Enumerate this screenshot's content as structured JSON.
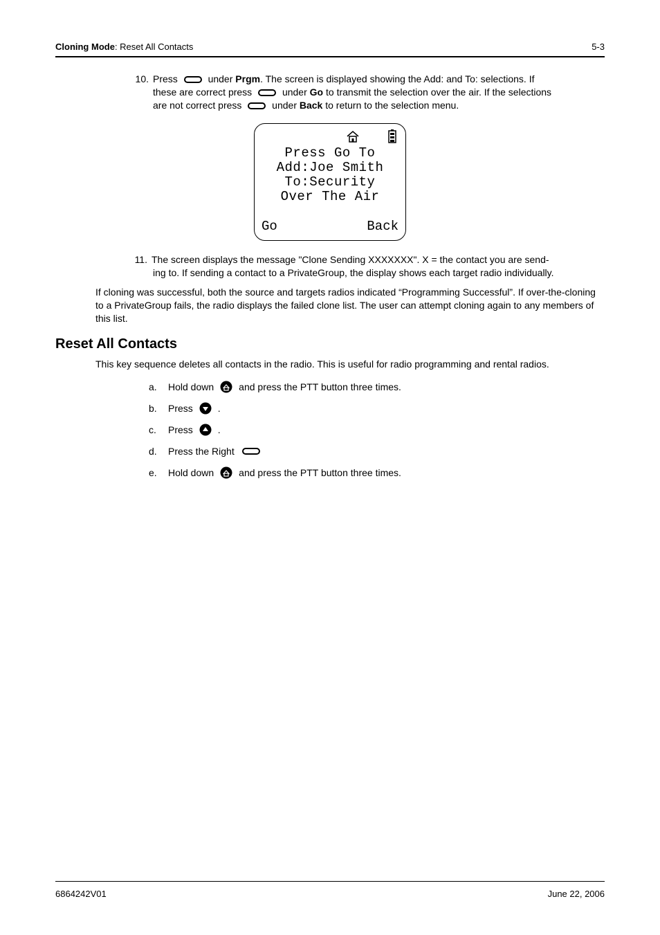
{
  "header": {
    "left_bold": "Cloning Mode",
    "left_rest": ": Reset All Contacts",
    "right": "5-3"
  },
  "step10": {
    "num": "10.",
    "t1a": "Press ",
    "t1b": " under ",
    "bold1": "Prgm",
    "t1c": ". The screen is displayed showing the Add: and To: selections. If",
    "t2a": "these are correct press ",
    "t2b": " under ",
    "bold2": "Go",
    "t2c": " to transmit the selection over the air. If the selections",
    "t3a": "are not correct press ",
    "t3b": " under ",
    "bold3": "Back",
    "t3c": " to return to the selection menu."
  },
  "screen": {
    "l1": "Press Go To",
    "l2": "Add:Joe Smith",
    "l3": "To:Security",
    "l4": "Over The Air",
    "left": "Go",
    "right": "Back"
  },
  "step11": {
    "num": "11.",
    "t1": "The screen displays the message \"Clone Sending XXXXXXX\". X = the contact you are send-",
    "t2": "ing to. If sending a contact to a PrivateGroup, the display shows each target radio individually."
  },
  "para1": "If cloning was successful, both the source and targets radios indicated “Programming Successful”. If over-the-cloning to a PrivateGroup fails, the radio displays the failed clone list. The user can attempt cloning again to any members of this list.",
  "heading": "Reset All Contacts",
  "para2": "This key sequence deletes all contacts in the radio. This is useful for radio programming and rental radios.",
  "sub": {
    "a": {
      "lbl": "a.",
      "t1": "Hold down ",
      "t2": " and press the PTT button three times."
    },
    "b": {
      "lbl": "b.",
      "t1": "Press ",
      "t2": "."
    },
    "c": {
      "lbl": "c.",
      "t1": "Press ",
      "t2": "."
    },
    "d": {
      "lbl": "d.",
      "t1": "Press the Right "
    },
    "e": {
      "lbl": "e.",
      "t1": "Hold down ",
      "t2": " and press the PTT button three times."
    }
  },
  "footer": {
    "left": "6864242V01",
    "right": "June 22, 2006"
  }
}
